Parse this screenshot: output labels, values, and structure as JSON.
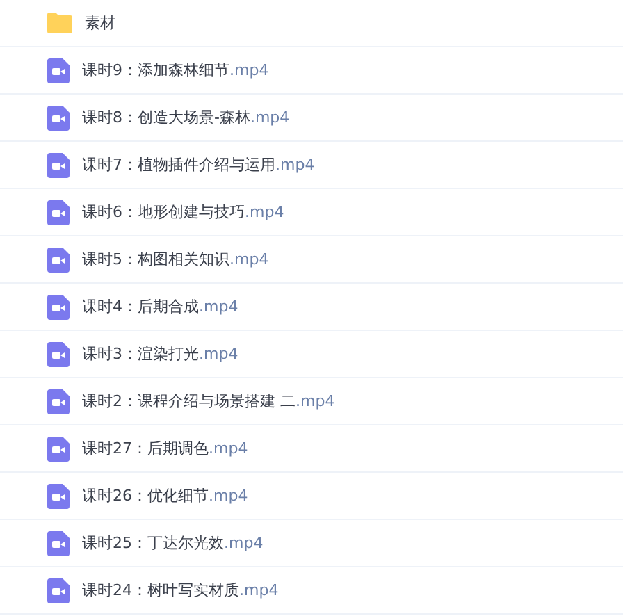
{
  "files": [
    {
      "kind": "folder",
      "name": "素材"
    },
    {
      "kind": "video",
      "name": "课时9：添加森林细节",
      "ext": ".mp4"
    },
    {
      "kind": "video",
      "name": "课时8：创造大场景-森林",
      "ext": ".mp4"
    },
    {
      "kind": "video",
      "name": "课时7：植物插件介绍与运用",
      "ext": ".mp4"
    },
    {
      "kind": "video",
      "name": "课时6：地形创建与技巧",
      "ext": ".mp4"
    },
    {
      "kind": "video",
      "name": "课时5：构图相关知识",
      "ext": ".mp4"
    },
    {
      "kind": "video",
      "name": "课时4：后期合成",
      "ext": ".mp4"
    },
    {
      "kind": "video",
      "name": "课时3：渲染打光",
      "ext": ".mp4"
    },
    {
      "kind": "video",
      "name": "课时2：课程介绍与场景搭建 二",
      "ext": ".mp4"
    },
    {
      "kind": "video",
      "name": "课时27：后期调色",
      "ext": ".mp4"
    },
    {
      "kind": "video",
      "name": "课时26：优化细节",
      "ext": ".mp4"
    },
    {
      "kind": "video",
      "name": "课时25：丁达尔光效",
      "ext": ".mp4"
    },
    {
      "kind": "video",
      "name": "课时24：树叶写实材质",
      "ext": ".mp4"
    }
  ]
}
